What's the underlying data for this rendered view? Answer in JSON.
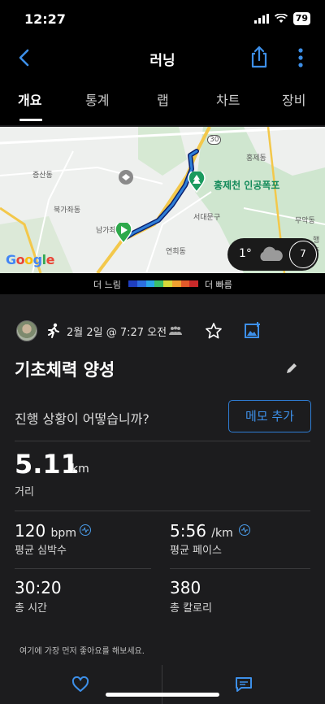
{
  "status": {
    "time": "12:27",
    "battery": "79"
  },
  "nav": {
    "title": "러닝"
  },
  "tabs": [
    {
      "label": "개요"
    },
    {
      "label": "통계"
    },
    {
      "label": "랩"
    },
    {
      "label": "차트"
    },
    {
      "label": "장비"
    }
  ],
  "map": {
    "labels": [
      "증산동",
      "홍제동",
      "북가좌동",
      "남가좌동",
      "서대문구",
      "무악동",
      "연희동",
      "행촌"
    ],
    "poi": "홍제천 인공폭포",
    "road": "30",
    "google": "Google",
    "weather_temp": "1°",
    "wind": "7"
  },
  "legend": {
    "slow": "더 느림",
    "fast": "더 빠름",
    "colors": [
      "#1f3fbf",
      "#2c6fe0",
      "#2aa7e8",
      "#3bbf6a",
      "#d7d93a",
      "#f0a030",
      "#e25a2a",
      "#c92a2a"
    ]
  },
  "activity": {
    "date": "2월 2일 @ 7:27 오전",
    "title": "기초체력 양성"
  },
  "progress": {
    "question": "진행 상황이 어떻습니까?",
    "memo_button": "메모 추가"
  },
  "stats": {
    "distance": {
      "value": "5.11",
      "unit": "km",
      "label": "거리"
    },
    "heart_rate": {
      "value": "120",
      "unit": "bpm",
      "label": "평균 심박수"
    },
    "pace": {
      "value": "5:56",
      "unit": "/km",
      "label": "평균 페이스"
    },
    "time": {
      "value": "30:20",
      "label": "총 시간"
    },
    "calories": {
      "value": "380",
      "label": "총 칼로리"
    }
  },
  "kudos": "여기에 가장 먼저 좋아요를 해보세요.",
  "colors": {
    "accent": "#3d8fe8",
    "route": "#2f7fd8",
    "park": "#1a9a5e"
  }
}
